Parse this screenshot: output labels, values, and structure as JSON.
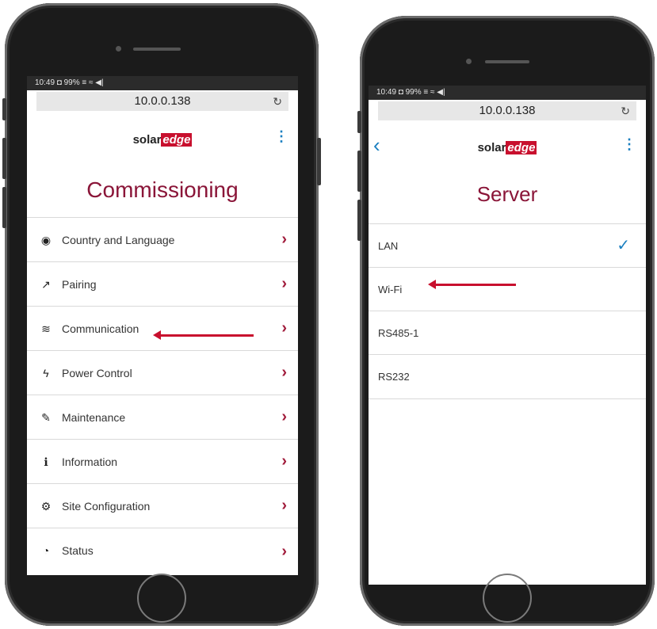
{
  "colors": {
    "accent": "#1a7fc0",
    "brand": "#c8102e",
    "title": "#8a1538",
    "chevron": "#a01a3a"
  },
  "left_phone": {
    "status_bar": "10:49 ◘ 99% ≡ ≈ ◀|",
    "url": "10.0.0.138",
    "reload_icon": "reload-icon",
    "logo": {
      "part1": "solar",
      "part2": "edge"
    },
    "title": "Commissioning",
    "menu": [
      {
        "icon": "globe-icon",
        "glyph": "◉",
        "label": "Country and Language"
      },
      {
        "icon": "pairing-icon",
        "glyph": "↗",
        "label": "Pairing"
      },
      {
        "icon": "wifi-icon",
        "glyph": "≋",
        "label": "Communication"
      },
      {
        "icon": "power-icon",
        "glyph": "ϟ",
        "label": "Power Control"
      },
      {
        "icon": "wrench-icon",
        "glyph": "✎",
        "label": "Maintenance"
      },
      {
        "icon": "info-icon",
        "glyph": "ℹ",
        "label": "Information"
      },
      {
        "icon": "gears-icon",
        "glyph": "⚙",
        "label": "Site Configuration"
      },
      {
        "icon": "dashboard-icon",
        "glyph": "◔",
        "label": "Status"
      }
    ]
  },
  "right_phone": {
    "status_bar": "10:49 ◘ 99% ≡ ≈ ◀|",
    "url": "10.0.0.138",
    "logo": {
      "part1": "solar",
      "part2": "edge"
    },
    "title": "Server",
    "items": [
      {
        "label": "LAN",
        "selected": true
      },
      {
        "label": "Wi-Fi",
        "selected": false
      },
      {
        "label": "RS485-1",
        "selected": false
      },
      {
        "label": "RS232",
        "selected": false
      }
    ]
  }
}
